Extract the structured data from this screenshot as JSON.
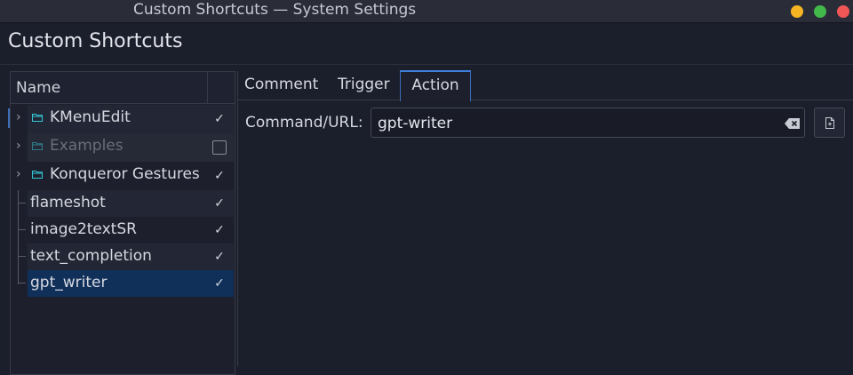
{
  "window": {
    "title": "Custom Shortcuts — System Settings"
  },
  "page": {
    "title": "Custom Shortcuts"
  },
  "tree": {
    "header": "Name",
    "items": [
      {
        "label": "KMenuEdit",
        "folder": true,
        "expandable": true,
        "checked": true,
        "enabled": true
      },
      {
        "label": "Examples",
        "folder": true,
        "expandable": true,
        "checked": false,
        "enabled": false
      },
      {
        "label": "Konqueror Gestures",
        "folder": true,
        "expandable": true,
        "checked": true,
        "enabled": true
      },
      {
        "label": "flameshot",
        "folder": false,
        "expandable": false,
        "checked": true,
        "enabled": true
      },
      {
        "label": "image2textSR",
        "folder": false,
        "expandable": false,
        "checked": true,
        "enabled": true
      },
      {
        "label": "text_completion",
        "folder": false,
        "expandable": false,
        "checked": true,
        "enabled": true
      },
      {
        "label": "gpt_writer",
        "folder": false,
        "expandable": false,
        "checked": true,
        "enabled": true,
        "selected": true
      }
    ]
  },
  "tabs": [
    {
      "label": "Comment",
      "active": false
    },
    {
      "label": "Trigger",
      "active": false
    },
    {
      "label": "Action",
      "active": true
    }
  ],
  "action": {
    "command_label": "Command/URL:",
    "command_value": "gpt-writer"
  },
  "colors": {
    "accent": "#3d7fd9",
    "selection": "#10305a",
    "folder_icon": "#34c8d8",
    "background": "#1b1e2b"
  },
  "icons": {
    "expander": "chevron-right-icon",
    "folder": "folder-icon",
    "check": "checkmark-icon",
    "clear": "clear-text-icon",
    "browse": "document-open-icon"
  }
}
